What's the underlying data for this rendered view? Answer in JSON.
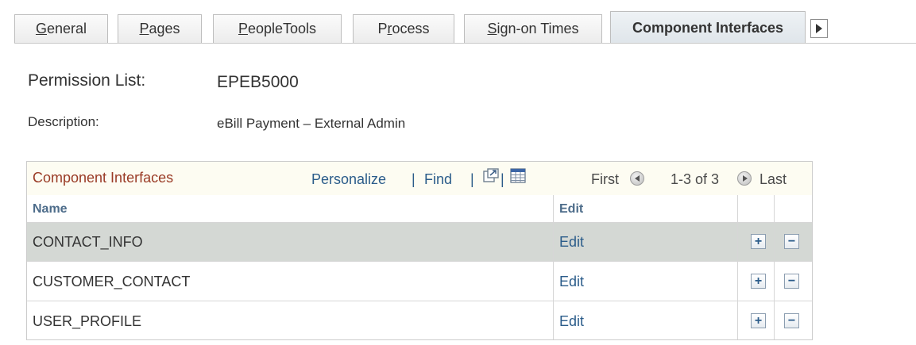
{
  "tabs": [
    {
      "pre": "",
      "u": "G",
      "post": "eneral"
    },
    {
      "pre": "",
      "u": "P",
      "post": "ages"
    },
    {
      "pre": "",
      "u": "P",
      "post": "eopleTools"
    },
    {
      "pre": "P",
      "u": "r",
      "post": "ocess"
    },
    {
      "pre": "",
      "u": "S",
      "post": "ign-on Times"
    },
    {
      "pre": "",
      "u": "",
      "post": "Component Interfaces"
    }
  ],
  "permission": {
    "label": "Permission List:",
    "value": "EPEB5000"
  },
  "description": {
    "label": "Description:",
    "value": "eBill Payment – External Admin"
  },
  "grid": {
    "title": "Component Interfaces",
    "personalize": "Personalize",
    "find": "Find",
    "sep": "|",
    "first": "First",
    "range": "1-3 of 3",
    "last": "Last",
    "columns": {
      "name": "Name",
      "edit": "Edit"
    },
    "rows": [
      {
        "name": "CONTACT_INFO",
        "edit": "Edit",
        "add": "+",
        "remove": "−"
      },
      {
        "name": "CUSTOMER_CONTACT",
        "edit": "Edit",
        "add": "+",
        "remove": "−"
      },
      {
        "name": "USER_PROFILE",
        "edit": "Edit",
        "add": "+",
        "remove": "−"
      }
    ]
  },
  "icons": {
    "tab_next": "chevron-right-icon",
    "zoom": "zoom-window-icon",
    "download": "grid-download-icon",
    "prev": "previous-circle-icon",
    "next": "next-circle-icon"
  },
  "colors": {
    "grid_title": "#9a3b26",
    "link": "#2b5c8a",
    "selected_row": "#d4d8d4",
    "grid_header_bg": "#fdfcf2"
  }
}
